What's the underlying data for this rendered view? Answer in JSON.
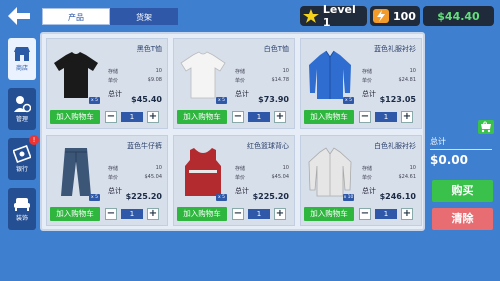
{
  "tabs": [
    {
      "label": "产品"
    },
    {
      "label": "货架"
    }
  ],
  "level": {
    "label": "Level 1"
  },
  "energy": {
    "value": "100"
  },
  "money": {
    "value": "$44.40"
  },
  "sidebar": {
    "items": [
      {
        "label": "商店",
        "icon": "shop-icon"
      },
      {
        "label": "管理",
        "icon": "manage-icon"
      },
      {
        "label": "银行",
        "icon": "bank-icon",
        "badge": "!"
      },
      {
        "label": "装饰",
        "icon": "sofa-icon"
      }
    ]
  },
  "stats_labels": {
    "stock": "存储",
    "price": "单价",
    "total": "总计"
  },
  "products": [
    {
      "name": "黑色T恤",
      "stock": "10",
      "price": "$9.08",
      "total": "$45.40",
      "badge": "x 5",
      "quantity": "1",
      "add_label": "加入购物车"
    },
    {
      "name": "白色T恤",
      "stock": "10",
      "price": "$14.78",
      "total": "$73.90",
      "badge": "x 5",
      "quantity": "1",
      "add_label": "加入购物车"
    },
    {
      "name": "蓝色礼服衬衫",
      "stock": "10",
      "price": "$24.81",
      "total": "$123.05",
      "badge": "x 5",
      "quantity": "1",
      "add_label": "加入购物车"
    },
    {
      "name": "蓝色牛仔裤",
      "stock": "10",
      "price": "$45.04",
      "total": "$225.20",
      "badge": "x 5",
      "quantity": "1",
      "add_label": "加入购物车"
    },
    {
      "name": "红色篮球背心",
      "stock": "10",
      "price": "$45.04",
      "total": "$225.20",
      "badge": "x 5",
      "quantity": "1",
      "add_label": "加入购物车"
    },
    {
      "name": "白色礼服衬衫",
      "stock": "10",
      "price": "$24.61",
      "total": "$246.10",
      "badge": "x 10",
      "quantity": "1",
      "add_label": "加入购物车"
    }
  ],
  "cart": {
    "total_label": "总计",
    "total_value": "$0.00",
    "badge": "0",
    "buy_label": "购买",
    "clear_label": "清除"
  },
  "colors": {
    "background": "#3f7fd0",
    "buy": "#3ac14c",
    "clear": "#e86d72",
    "money": "#63e07a",
    "add_button": "#2eb63e"
  }
}
